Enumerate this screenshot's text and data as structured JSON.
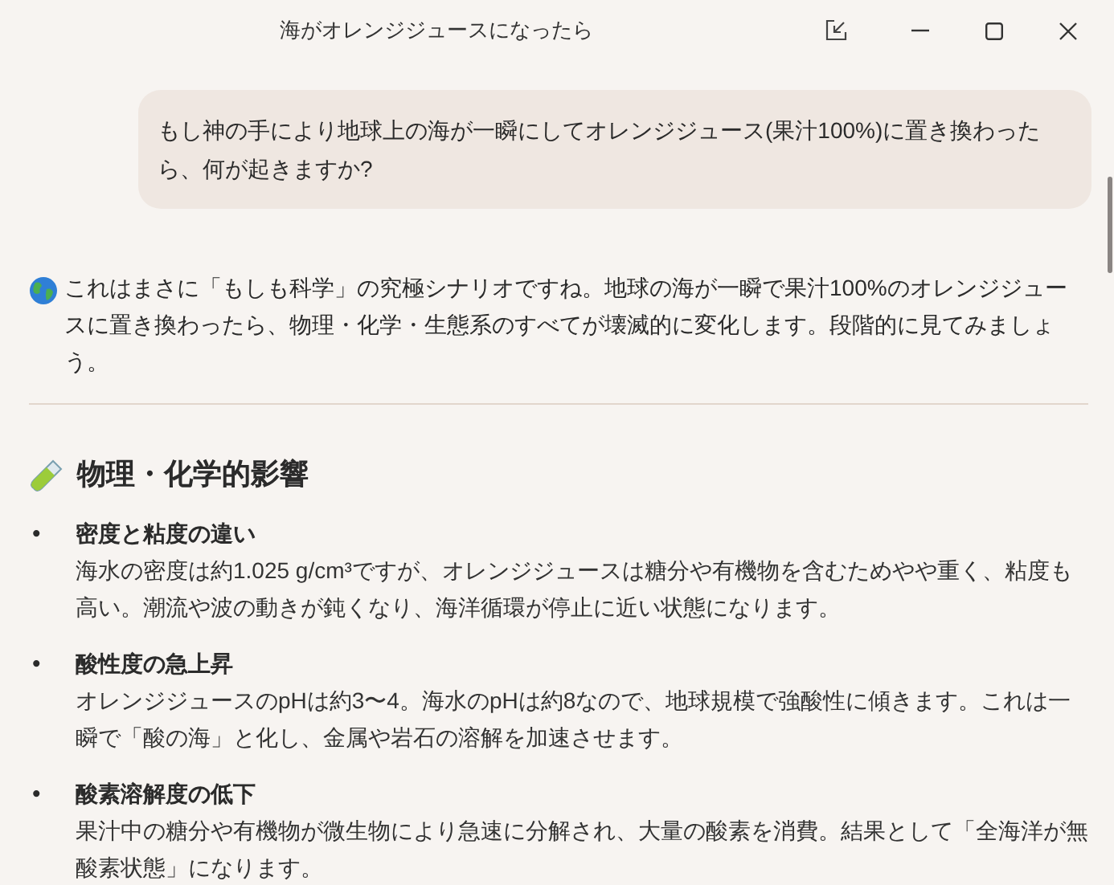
{
  "window": {
    "title": "海がオレンジジュースになったら"
  },
  "user_message": "もし神の手により地球上の海が一瞬にしてオレンジジュース(果汁100%)に置き換わったら、何が起きますか?",
  "response": {
    "intro": "これはまさに「もしも科学」の究極シナリオですね。地球の海が一瞬で果汁100%のオレンジジュースに置き換わったら、物理・化学・生態系のすべてが壊滅的に変化します。段階的に見てみましょう。",
    "section": {
      "heading": "物理・化学的影響",
      "items": [
        {
          "marker": "•",
          "title": "密度と粘度の違い",
          "body": "海水の密度は約1.025 g/cm³ですが、オレンジジュースは糖分や有機物を含むためやや重く、粘度も高い。潮流や波の動きが鈍くなり、海洋循環が停止に近い状態になります。"
        },
        {
          "marker": "•",
          "title": "酸性度の急上昇",
          "body": "オレンジジュースのpHは約3〜4。海水のpHは約8なので、地球規模で強酸性に傾きます。これは一瞬で「酸の海」と化し、金属や岩石の溶解を加速させます。"
        },
        {
          "marker": "•",
          "title": "酸素溶解度の低下",
          "body": "果汁中の糖分や有機物が微生物により急速に分解され、大量の酸素を消費。結果として「全海洋が無酸素状態」になります。"
        }
      ]
    }
  }
}
